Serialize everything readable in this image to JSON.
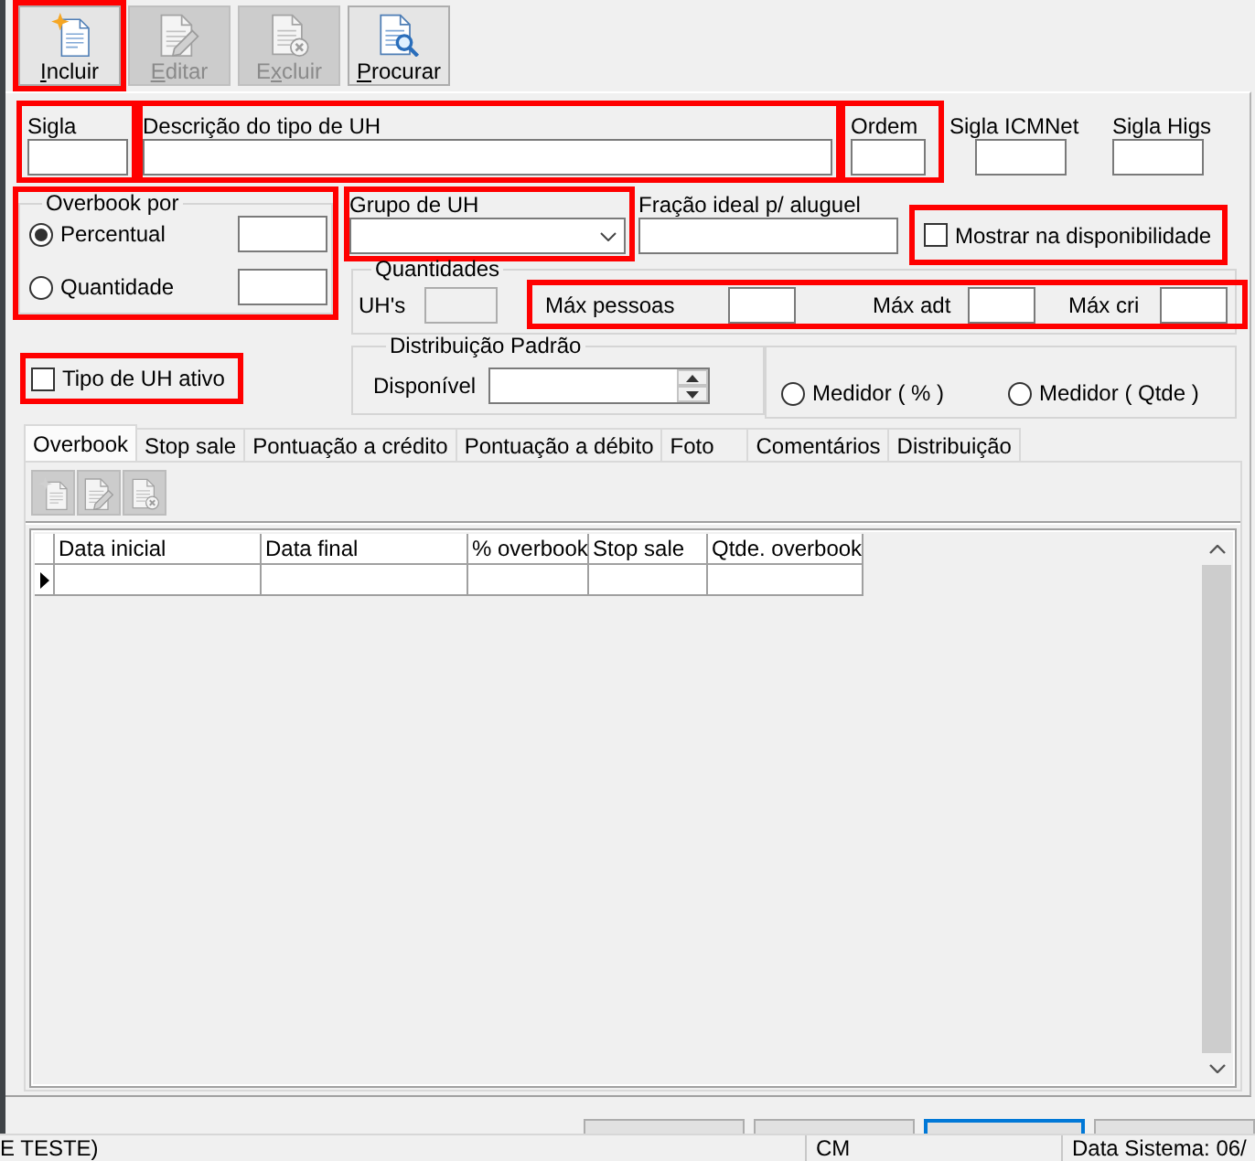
{
  "toolbar": {
    "buttons": [
      {
        "kind": "add",
        "access_key": "I",
        "rest": "ncluir",
        "disabled": false,
        "highlighted": true
      },
      {
        "kind": "edit",
        "access_key": "E",
        "rest": "ditar",
        "disabled": true,
        "highlighted": false
      },
      {
        "kind": "delete",
        "lead": "E",
        "access_key": "x",
        "rest": "cluir",
        "disabled": true,
        "highlighted": false
      },
      {
        "kind": "search",
        "access_key": "P",
        "rest": "rocurar",
        "disabled": false,
        "highlighted": false
      }
    ]
  },
  "identity_fields": [
    {
      "label": "Sigla",
      "highlighted": true
    },
    {
      "label": "Descrição do tipo de UH",
      "highlighted": true
    },
    {
      "label": "Ordem",
      "highlighted": true
    },
    {
      "label": "Sigla ICMNet",
      "highlighted": false
    },
    {
      "label": "Sigla Higs",
      "highlighted": false
    }
  ],
  "overbook": {
    "label": "Overbook por",
    "highlighted": true,
    "options": [
      {
        "label": "Percentual",
        "selected": true
      },
      {
        "label": "Quantidade",
        "selected": false
      }
    ]
  },
  "unit_group": {
    "label": "Grupo de UH",
    "highlighted": true
  },
  "fraction": {
    "label": "Fração ideal p/ aluguel"
  },
  "show_in_availability": {
    "label": "Mostrar na disponibilidade",
    "checked": false,
    "highlighted": true
  },
  "quantities": {
    "label": "Quantidades",
    "units": {
      "label": "UH's",
      "disabled": true
    },
    "maximums": {
      "highlighted": true,
      "fields": [
        {
          "label": "Máx pessoas"
        },
        {
          "label": "Máx adt"
        },
        {
          "label": "Máx cri"
        }
      ]
    }
  },
  "active": {
    "label": "Tipo de UH ativo",
    "checked": false,
    "highlighted": true
  },
  "default_distribution": {
    "label": "Distribuição Padrão",
    "available": {
      "label": "Disponível"
    }
  },
  "meter_options": [
    {
      "label": "Medidor ( % )",
      "selected": false
    },
    {
      "label": "Medidor ( Qtde )",
      "selected": false
    }
  ],
  "tabs": [
    {
      "label": "Overbook",
      "selected": true
    },
    {
      "label": "Stop sale",
      "selected": false
    },
    {
      "label": "Pontuação a crédito",
      "selected": false
    },
    {
      "label": "Pontuação a débito",
      "selected": false
    },
    {
      "label": "Foto",
      "selected": false
    },
    {
      "label": "Comentários",
      "selected": false
    },
    {
      "label": "Distribuição",
      "selected": false
    }
  ],
  "tab_toolbar": [
    {
      "kind": "add",
      "disabled": true
    },
    {
      "kind": "edit",
      "disabled": true
    },
    {
      "kind": "delete",
      "disabled": true
    }
  ],
  "grid": {
    "columns": [
      "Data inicial",
      "Data final",
      "% overbook",
      "Stop sale",
      "Qtde. overbook"
    ],
    "rows": [
      {
        "current": true
      }
    ]
  },
  "footer_buttons": [
    {
      "focused": false
    },
    {
      "focused": false
    },
    {
      "focused": true
    },
    {
      "focused": false
    }
  ],
  "status_bar": {
    "panels": [
      "E TESTE)",
      "CM",
      "Data Sistema: 06/"
    ]
  }
}
